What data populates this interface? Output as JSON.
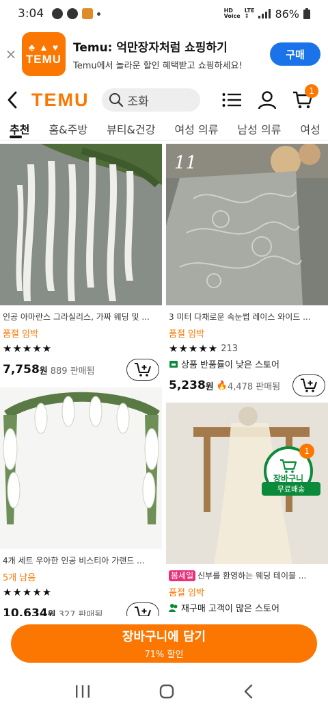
{
  "status": {
    "time": "3:04",
    "battery": "86%"
  },
  "banner": {
    "close": "×",
    "logo_word": "TEMU",
    "title": "Temu: 억만장자처럼 쇼핑하기",
    "subtitle": "Temu에서 놀라운 할인 혜택받고 쇼핑하세요!",
    "install": "구매"
  },
  "header": {
    "brand": "TEMU",
    "search_placeholder": "조화",
    "cart_count": "1"
  },
  "tabs": [
    "추천",
    "홈&주방",
    "뷰티&건강",
    "여성 의류",
    "남성 의류",
    "여성"
  ],
  "products": [
    {
      "name": "인공 아마란스 그라실리스, 가짜 웨딩 및 ...",
      "tag": "품절 임박",
      "stars": "★★★★★",
      "review_count": "",
      "price": "7,758",
      "won": "원",
      "sold": "889 판매됨"
    },
    {
      "name": "3 미터 다채로운 속눈썹 레이스 와이드 ...",
      "tag": "품절 임박",
      "stars": "★★★★★",
      "review_count": "213",
      "info": "상품 반품률이 낮은 스토어",
      "price": "5,238",
      "won": "원",
      "sold": "4,478 판매됨",
      "image_label": "11"
    },
    {
      "name": "4개 세트 우아한 인공 비스티아 가랜드 ...",
      "tag": "5개 남음",
      "stars": "★★★★★",
      "review_count": "",
      "price": "10,634",
      "won": "원",
      "sold": "327 판매됨"
    },
    {
      "sale_badge": "봄세일",
      "name": "신부를 환영하는 웨딩 테이블 ...",
      "tag": "품절 임박",
      "info": "재구매 고객이 많은 스토어"
    }
  ],
  "float_cart": {
    "label": "장바구니",
    "count": "1",
    "free_shipping": "무료배송"
  },
  "cta": {
    "main": "장바구니에 담기",
    "sub": "71% 할인"
  },
  "colors": {
    "brand": "#fb7701",
    "install": "#1a73e8",
    "green": "#0a8a3a",
    "sale": "#e8317b"
  }
}
